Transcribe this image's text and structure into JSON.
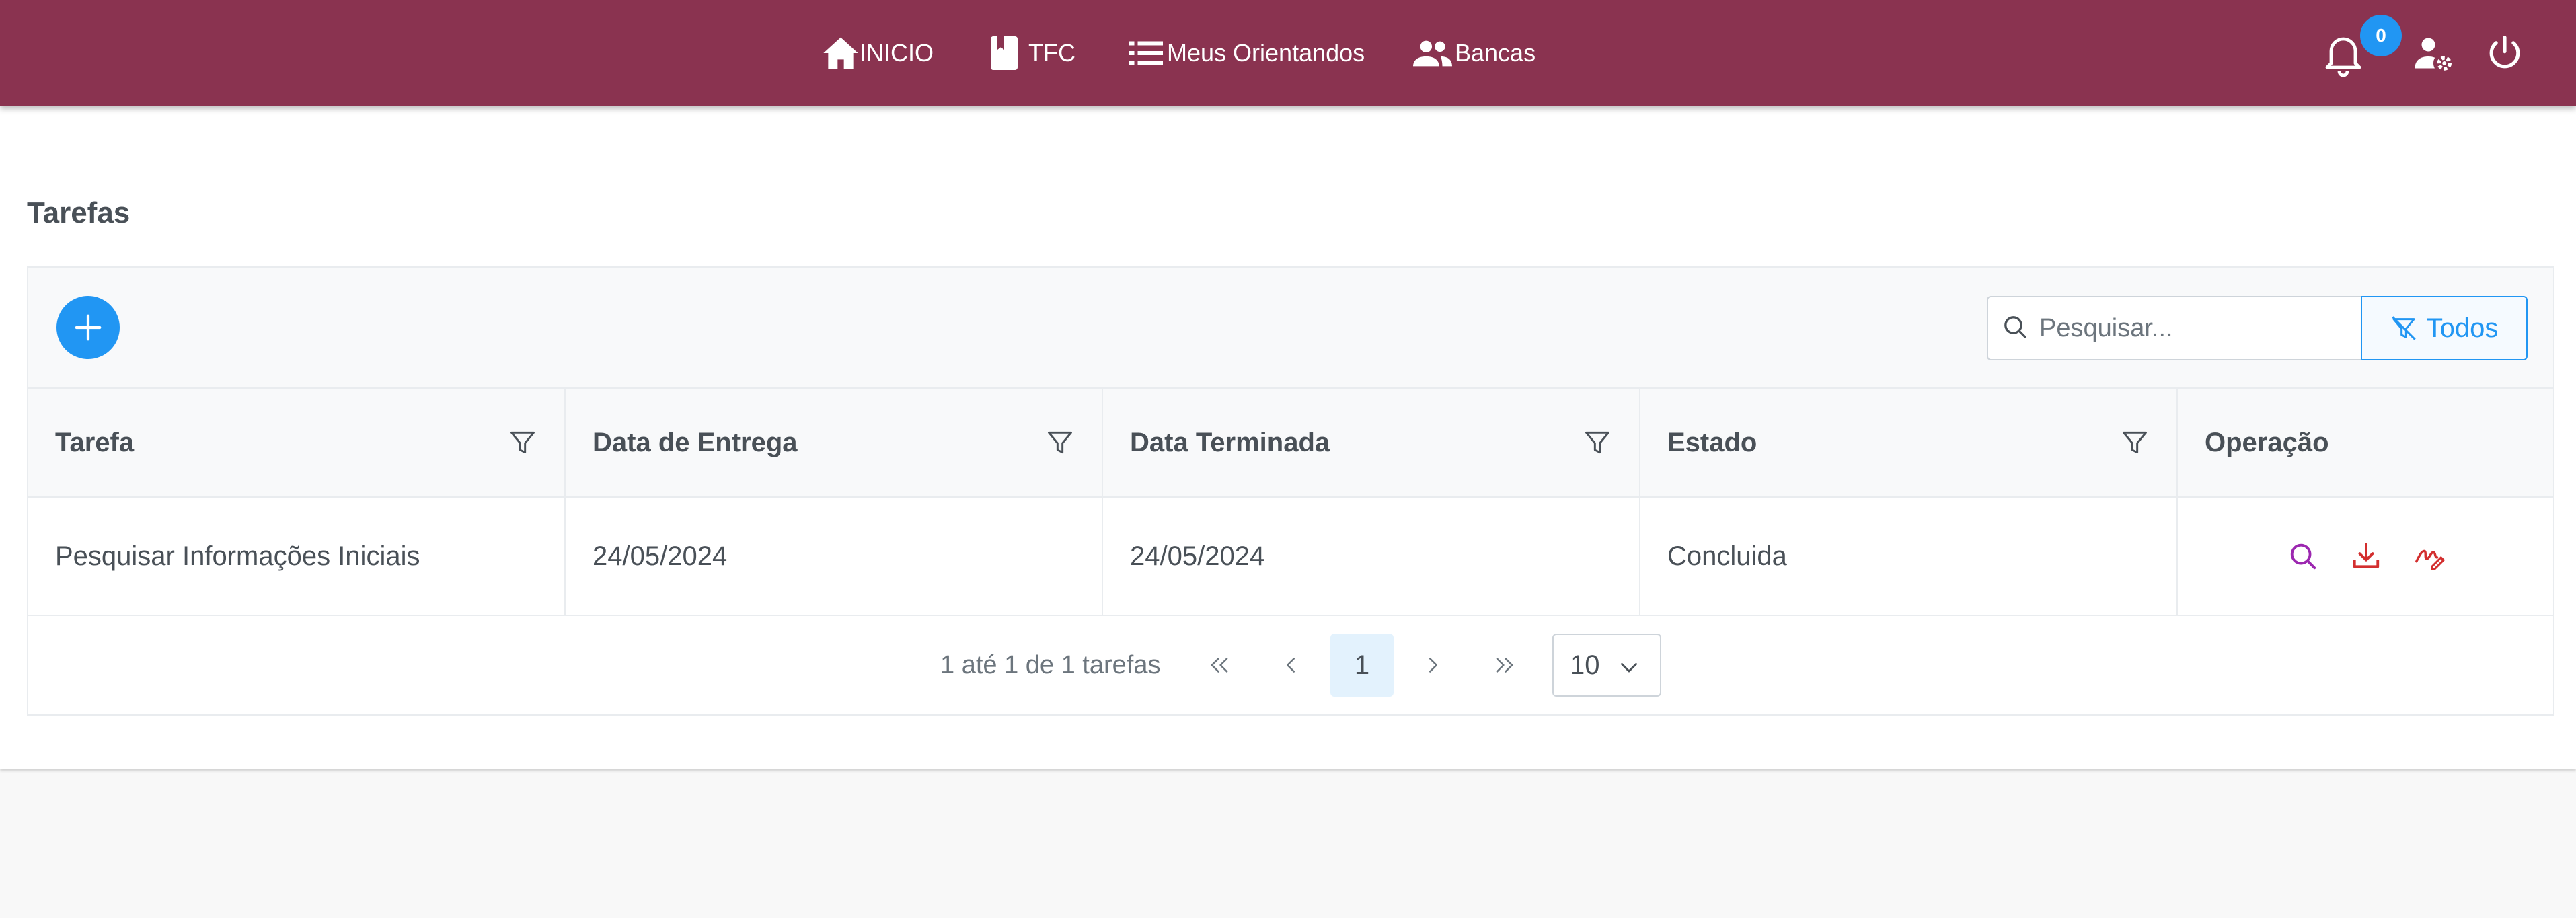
{
  "nav": {
    "inicio": "INICIO",
    "tfc": "TFC",
    "orientandos": "Meus Orientandos",
    "bancas": "Bancas"
  },
  "notifications": {
    "count": "0"
  },
  "page": {
    "title": "Tarefas"
  },
  "toolbar": {
    "search_placeholder": "Pesquisar...",
    "filter_label": "Todos"
  },
  "table": {
    "headers": [
      "Tarefa",
      "Data de Entrega",
      "Data Terminada",
      "Estado",
      "Operação"
    ],
    "rows": [
      {
        "tarefa": "Pesquisar Informações Iniciais",
        "entrega": "24/05/2024",
        "terminada": "24/05/2024",
        "estado": "Concluida"
      }
    ]
  },
  "paginator": {
    "report": "1 até 1 de 1 tarefas",
    "current_page": "1",
    "rows_per_page": "10"
  },
  "colors": {
    "topbar": "#8a3350",
    "primary": "#2196f3",
    "view_icon": "#9c27b0",
    "action_icon": "#d32f2f"
  },
  "icons": [
    "home-icon",
    "book-icon",
    "list-icon",
    "users-icon",
    "bell-icon",
    "user-cog-icon",
    "power-icon",
    "plus-icon",
    "search-icon",
    "filter-icon",
    "download-icon",
    "sign-icon"
  ]
}
